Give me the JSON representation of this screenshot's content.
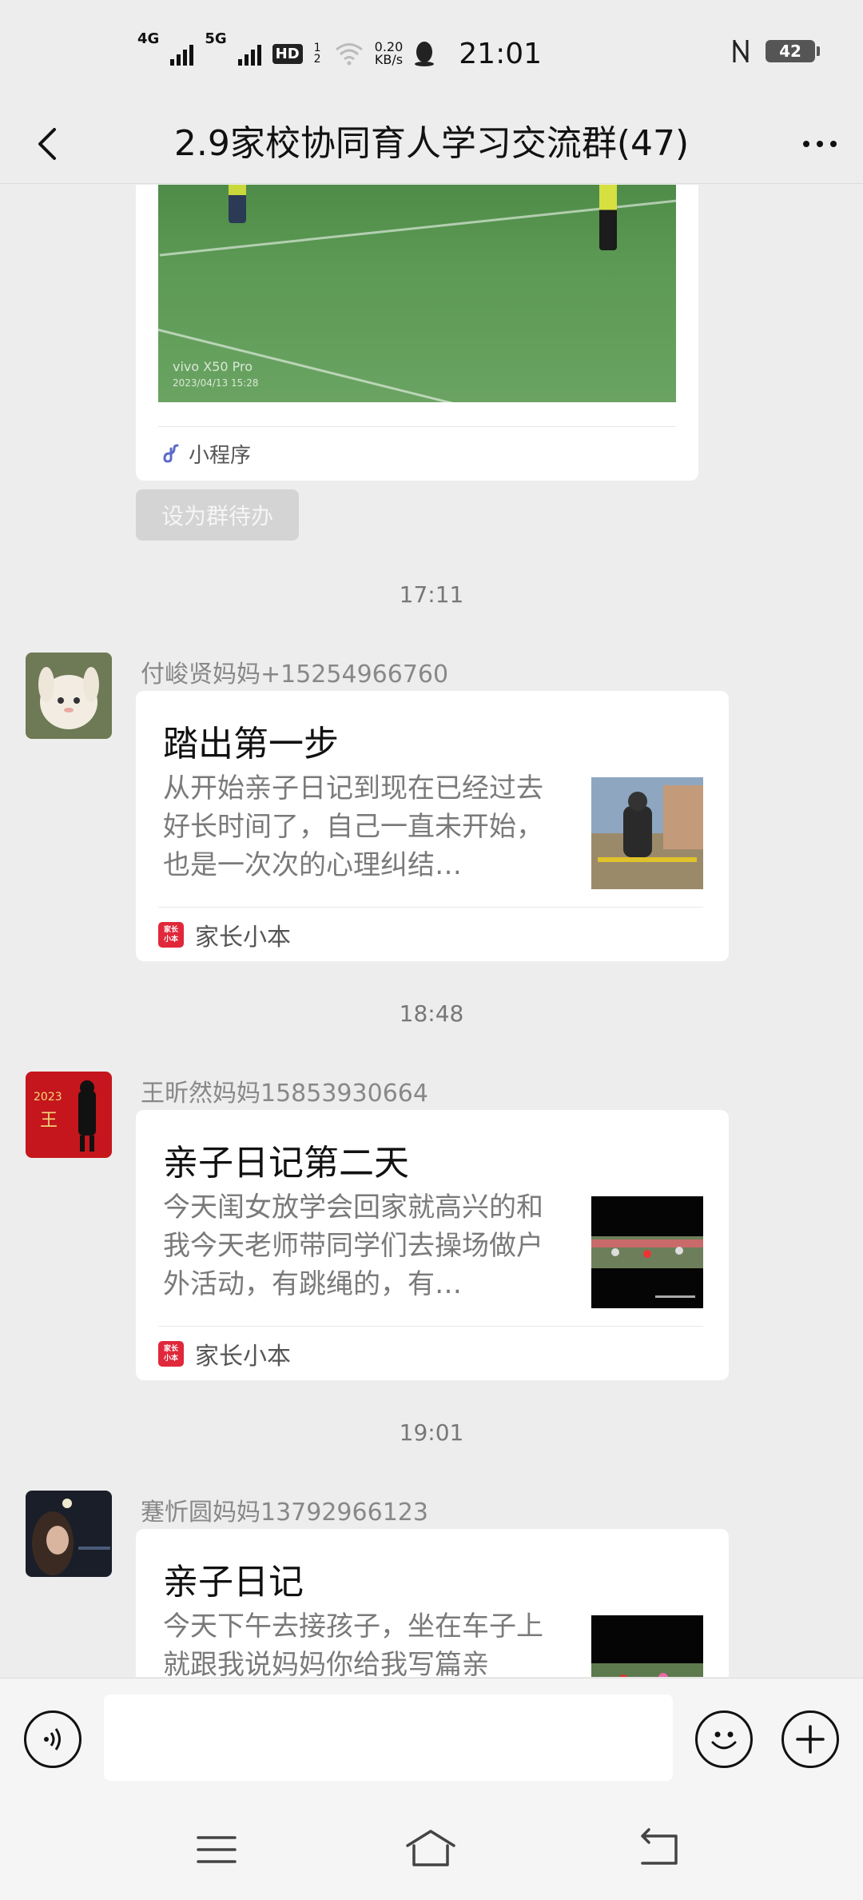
{
  "status_bar": {
    "net1": "4G",
    "net2": "5G",
    "hd": "HD",
    "hd_sub": "1 2",
    "speed_value": "0.20",
    "speed_unit": "KB/s",
    "time": "21:01",
    "battery": "42"
  },
  "header": {
    "title": "2.9家校协同育人学习交流群(47)"
  },
  "mini_program_card": {
    "watermark_device": "vivo X50 Pro",
    "watermark_date": "2023/04/13 15:28",
    "source": "小程序"
  },
  "todo_button": "设为群待办",
  "messages": [
    {
      "time": "17:11",
      "sender": "付峻贤妈妈+15254966760",
      "title": "踏出第一步",
      "desc": "从开始亲子日记到现在已经过去好长时间了，自己一直未开始，也是一次次的心理纠结…",
      "app": "家长小本"
    },
    {
      "time": "18:48",
      "sender": "王昕然妈妈15853930664",
      "title": "亲子日记第二天",
      "desc": "今天闺女放学会回家就高兴的和我今天老师带同学们去操场做户外活动，有跳绳的，有…",
      "app": "家长小本",
      "avatar_text_year": "2023",
      "avatar_text_char": "王"
    },
    {
      "time": "19:01",
      "sender": "蹇忻圆妈妈13792966123",
      "title": "亲子日记",
      "desc": "今天下午去接孩子，坐在车子上就跟我说妈妈你给我写篇亲"
    }
  ],
  "app_logo_text": "家长小本",
  "input_bar": {
    "placeholder": ""
  },
  "colors": {
    "background": "#ededed",
    "card": "#ffffff",
    "app_logo": "#e0283a"
  }
}
